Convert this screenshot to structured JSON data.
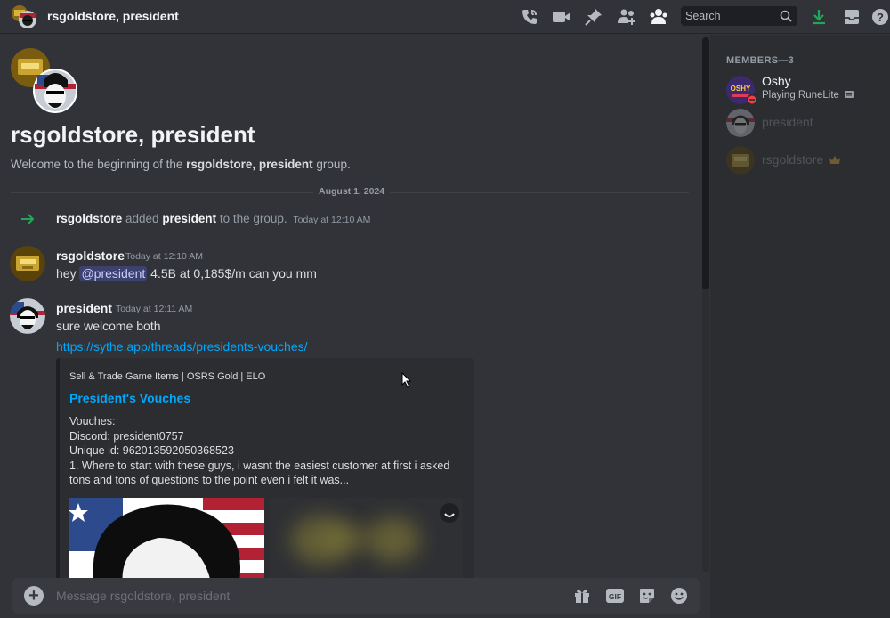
{
  "header": {
    "title": "rsgoldstore, president",
    "search_placeholder": "Search"
  },
  "welcome": {
    "title": "rsgoldstore, president",
    "subtitle_prefix": "Welcome to the beginning of the ",
    "subtitle_name": "rsgoldstore, president",
    "subtitle_suffix": " group."
  },
  "date_divider": "August 1, 2024",
  "system_message": {
    "actor": "rsgoldstore",
    "action": " added ",
    "target": "president",
    "suffix": " to the group.",
    "timestamp": "Today at 12:10 AM"
  },
  "messages": [
    {
      "author": "rsgoldstore",
      "timestamp": "Today at 12:10 AM",
      "text_prefix": "hey ",
      "mention": "@president",
      "text_suffix": " 4.5B at 0,185$/m can you mm"
    },
    {
      "author": "president",
      "timestamp": "Today at 12:11 AM",
      "text": "sure welcome both",
      "link": "https://sythe.app/threads/presidents-vouches/"
    }
  ],
  "embed": {
    "provider": "Sell & Trade Game Items | OSRS Gold | ELO",
    "title": "President's Vouches",
    "lines": [
      "Vouches:",
      "Discord: president0757",
      "Unique id: 962013592050368523",
      "1. Where to start with these guys, i wasnt the easiest customer at first i asked tons and tons of questions to the point even i felt it was..."
    ]
  },
  "composer": {
    "placeholder": "Message rsgoldstore, president",
    "gif_label": "GIF"
  },
  "members": {
    "header": "MEMBERS—3",
    "list": [
      {
        "name": "Oshy",
        "activity": "Playing RuneLite",
        "badge": "app-icon",
        "name_color": "#f2f3f5",
        "offline": false
      },
      {
        "name": "president",
        "activity": "",
        "badge": "",
        "name_color": "#949ba4",
        "offline": true
      },
      {
        "name": "rsgoldstore",
        "activity": "",
        "badge": "crown-icon",
        "name_color": "#949ba4",
        "offline": true
      }
    ]
  },
  "icons": [
    "phone-call-icon",
    "video-icon",
    "pin-icon",
    "add-friend-icon",
    "members-icon",
    "search-icon",
    "download-icon",
    "inbox-icon",
    "help-icon",
    "arrow-right-icon",
    "plus-icon",
    "gift-icon",
    "gif-icon",
    "sticker-icon",
    "emoji-icon"
  ],
  "colors": {
    "accent_link": "#00a8fc",
    "mention_bg": "#5865f2",
    "download_green": "#23a55a",
    "crown": "#f0b232"
  }
}
